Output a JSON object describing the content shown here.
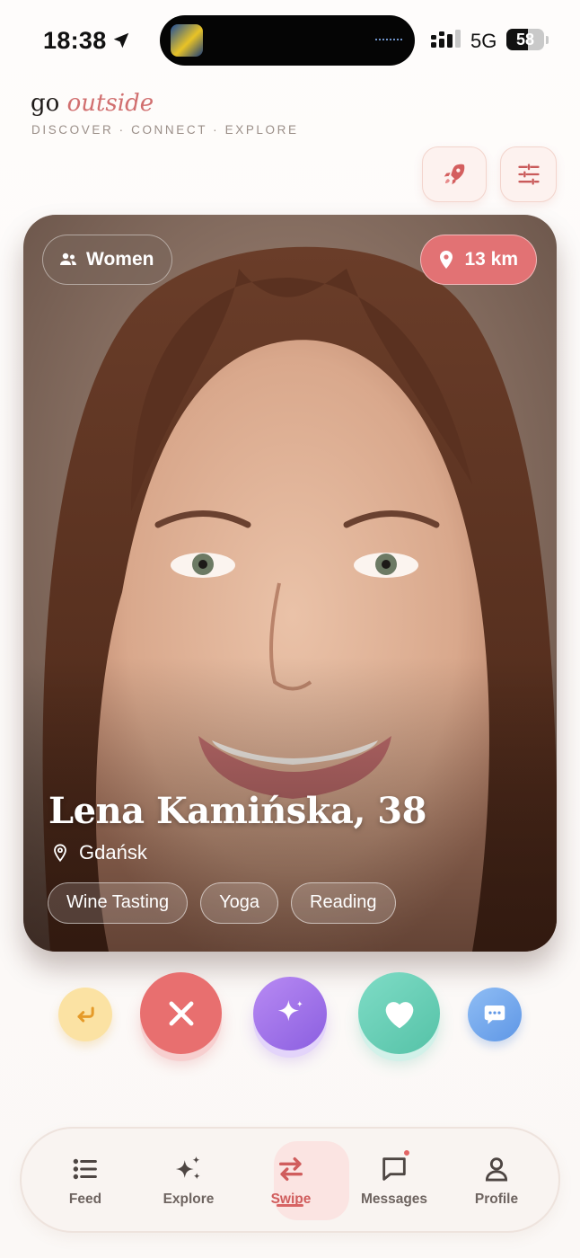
{
  "status_bar": {
    "time": "18:38",
    "network": "5G",
    "battery": "58",
    "battery_level": 0.58
  },
  "brand": {
    "word1": "go",
    "word2": "outside",
    "tagline": "DISCOVER · CONNECT · EXPLORE"
  },
  "header_actions": {
    "boost_icon": "rocket-icon",
    "filter_icon": "sliders-icon"
  },
  "card": {
    "gender_filter": "Women",
    "distance": "13 km",
    "name_age": "Lena Kamińska, 38",
    "city": "Gdańsk",
    "interests": [
      "Wine Tasting",
      "Yoga",
      "Reading"
    ]
  },
  "actions": {
    "undo_icon": "undo-icon",
    "pass_icon": "close-icon",
    "superlike_icon": "sparkle-icon",
    "like_icon": "heart-icon",
    "message_icon": "chat-icon"
  },
  "colors": {
    "accent": "#e27274",
    "pass": "#e86f6f",
    "superlike": "#9b6fe8",
    "like": "#62c8ae",
    "message": "#6fa5ea",
    "undo": "#fbe2a3"
  },
  "nav": {
    "items": [
      {
        "label": "Feed",
        "icon": "list-icon"
      },
      {
        "label": "Explore",
        "icon": "sparkles-icon"
      },
      {
        "label": "Swipe",
        "icon": "swap-icon"
      },
      {
        "label": "Messages",
        "icon": "message-square-icon"
      },
      {
        "label": "Profile",
        "icon": "user-icon"
      }
    ],
    "active": "Swipe"
  }
}
